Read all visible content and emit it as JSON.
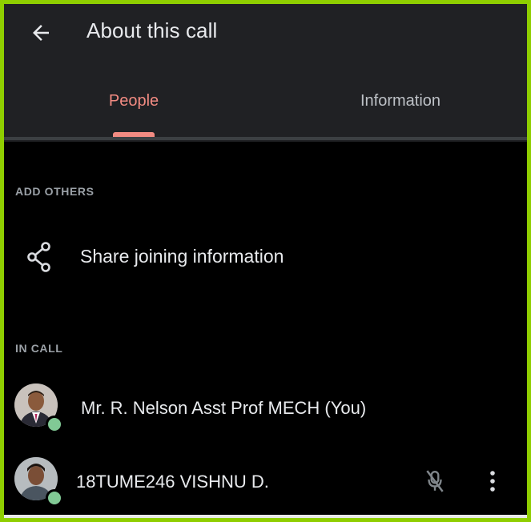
{
  "header": {
    "back_icon": "arrow-left-icon",
    "title": "About this call"
  },
  "tabs": [
    {
      "label": "People",
      "active": true
    },
    {
      "label": "Information",
      "active": false
    }
  ],
  "colors": {
    "accent": "#f28b82",
    "frame": "#8fce00",
    "header_bg": "#202124",
    "online": "#81c995"
  },
  "add_others": {
    "section_label": "ADD OTHERS",
    "share_icon": "share-icon",
    "share_label": "Share joining information"
  },
  "in_call": {
    "section_label": "IN CALL",
    "participants": [
      {
        "name": "Mr. R. Nelson Asst Prof MECH (You)",
        "online": true
      },
      {
        "name": "18TUME246 VISHNU D.",
        "online": true,
        "mic_icon": "mic-off-icon",
        "more_icon": "more-vert-icon"
      }
    ]
  }
}
